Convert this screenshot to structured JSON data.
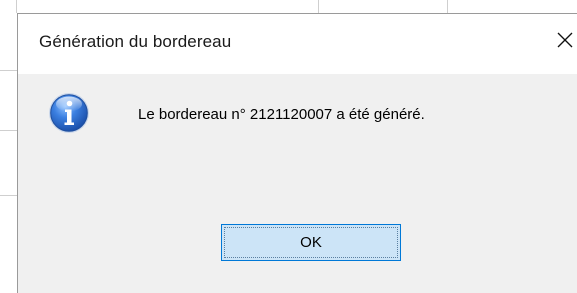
{
  "dialog": {
    "title": "Génération du bordereau",
    "message": "Le bordereau n° 2121120007 a été généré.",
    "ok_label": "OK",
    "close_glyph": "✕",
    "icon": "information-icon"
  },
  "colors": {
    "titlebar_bg": "#ffffff",
    "dialog_bg": "#f0f0f0",
    "button_bg": "#cce4f7",
    "button_border": "#0078d7",
    "info_icon_blue": "#1f5fbf"
  }
}
